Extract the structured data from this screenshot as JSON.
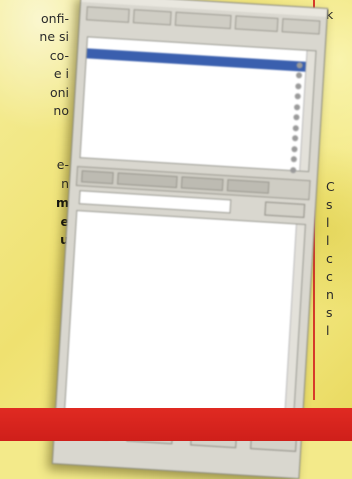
{
  "article": {
    "left_lines": [
      "onfi-",
      "ne si",
      "co-",
      "e i",
      "oni",
      "no",
      "e-",
      "n",
      "m",
      "e",
      "u"
    ],
    "left_bold": [
      false,
      false,
      false,
      false,
      false,
      false,
      false,
      false,
      true,
      true,
      true
    ],
    "right_lines": [
      "k",
      "C",
      "s",
      "l",
      "l",
      "c",
      "c",
      "n",
      "s",
      "l"
    ]
  },
  "window": {
    "tabs": [
      "",
      "",
      "",
      "",
      ""
    ],
    "top_list": [
      "",
      "",
      "",
      "",
      "",
      "",
      "",
      "",
      "",
      "",
      "",
      ""
    ],
    "selected_index": 1,
    "bottom_list": [
      "",
      "",
      "",
      "",
      "",
      "",
      "",
      "",
      "",
      "",
      "",
      "",
      "",
      "",
      "",
      ""
    ],
    "footer_buttons": [
      "",
      "",
      "",
      ""
    ]
  }
}
